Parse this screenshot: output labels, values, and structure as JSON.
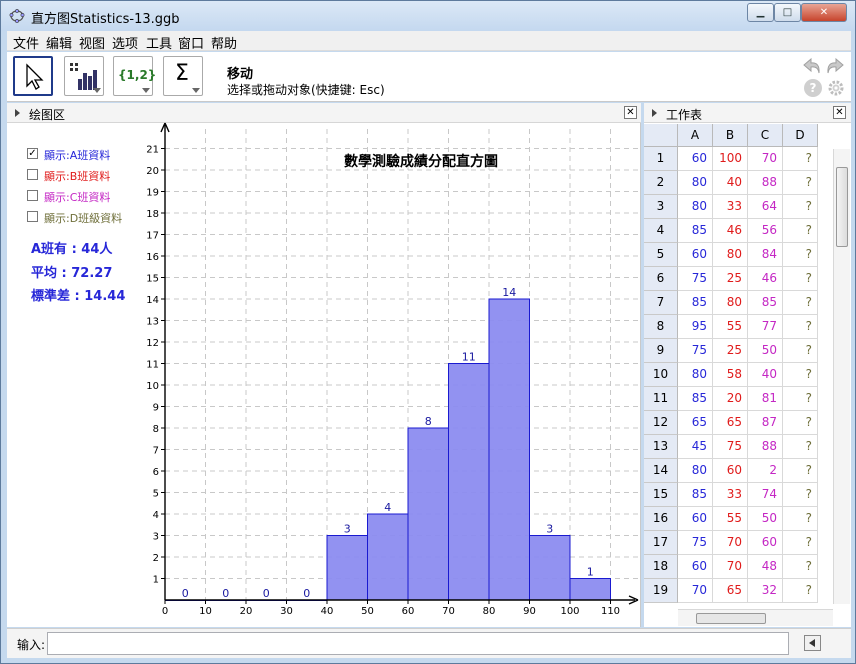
{
  "window": {
    "title": "直方图Statistics-13.ggb",
    "min_glyph": "▁",
    "max_glyph": "□",
    "close_glyph": "✕"
  },
  "menu": [
    "文件",
    "编辑",
    "视图",
    "选项",
    "工具",
    "窗口",
    "帮助"
  ],
  "toolbar": {
    "tool_name": "移动",
    "tool_help": "选择或拖动对象(快捷键: Esc)",
    "list_tool_label": "{1,2}",
    "sum_tool_label": "Σ",
    "help_glyph": "?"
  },
  "graphics": {
    "header": "绘图区",
    "checkboxes": [
      {
        "label": "顯示:A班資料",
        "checked": true,
        "color": "#2727d8"
      },
      {
        "label": "顯示:B班資料",
        "checked": false,
        "color": "#e01b1b"
      },
      {
        "label": "顯示:C班資料",
        "checked": false,
        "color": "#c427c4"
      },
      {
        "label": "顯示:D班級資料",
        "checked": false,
        "color": "#6f6f3a"
      }
    ],
    "stats": [
      "A班有 : 44人",
      "平均 : 72.27",
      "標準差 : 14.44"
    ]
  },
  "chart_data": {
    "type": "bar",
    "title": "數學測驗成績分配直方圖",
    "bins": [
      [
        0,
        10
      ],
      [
        10,
        20
      ],
      [
        20,
        30
      ],
      [
        30,
        40
      ],
      [
        40,
        50
      ],
      [
        50,
        60
      ],
      [
        60,
        70
      ],
      [
        70,
        80
      ],
      [
        80,
        90
      ],
      [
        90,
        100
      ],
      [
        100,
        110
      ]
    ],
    "values": [
      0,
      0,
      0,
      0,
      3,
      4,
      8,
      11,
      14,
      3,
      1
    ],
    "xlim": [
      0,
      110
    ],
    "ylim": [
      0,
      21
    ],
    "x_ticks": [
      0,
      10,
      20,
      30,
      40,
      50,
      60,
      70,
      80,
      90,
      100,
      110
    ],
    "y_ticks": [
      1,
      2,
      3,
      4,
      5,
      6,
      7,
      8,
      9,
      10,
      11,
      12,
      13,
      14,
      15,
      16,
      17,
      18,
      19,
      20,
      21
    ],
    "grid": true,
    "bar_color": "#8c8cf0",
    "label_color": "#1a1aa0"
  },
  "spreadsheet": {
    "header": "工作表",
    "columns": [
      "A",
      "B",
      "C",
      "D"
    ],
    "column_colors": [
      "#2727d8",
      "#e01b1b",
      "#c427c4",
      "#6f6f3a"
    ],
    "rows": [
      [
        "60",
        "100",
        "70",
        "?"
      ],
      [
        "80",
        "40",
        "88",
        "?"
      ],
      [
        "80",
        "33",
        "64",
        "?"
      ],
      [
        "85",
        "46",
        "56",
        "?"
      ],
      [
        "60",
        "80",
        "84",
        "?"
      ],
      [
        "75",
        "25",
        "46",
        "?"
      ],
      [
        "85",
        "80",
        "85",
        "?"
      ],
      [
        "95",
        "55",
        "77",
        "?"
      ],
      [
        "75",
        "25",
        "50",
        "?"
      ],
      [
        "80",
        "58",
        "40",
        "?"
      ],
      [
        "85",
        "20",
        "81",
        "?"
      ],
      [
        "65",
        "65",
        "87",
        "?"
      ],
      [
        "45",
        "75",
        "88",
        "?"
      ],
      [
        "80",
        "60",
        "2",
        "?"
      ],
      [
        "85",
        "33",
        "74",
        "?"
      ],
      [
        "60",
        "55",
        "50",
        "?"
      ],
      [
        "75",
        "70",
        "60",
        "?"
      ],
      [
        "60",
        "70",
        "48",
        "?"
      ],
      [
        "70",
        "65",
        "32",
        "?"
      ]
    ]
  },
  "input_bar": {
    "label": "输入:",
    "value": ""
  }
}
